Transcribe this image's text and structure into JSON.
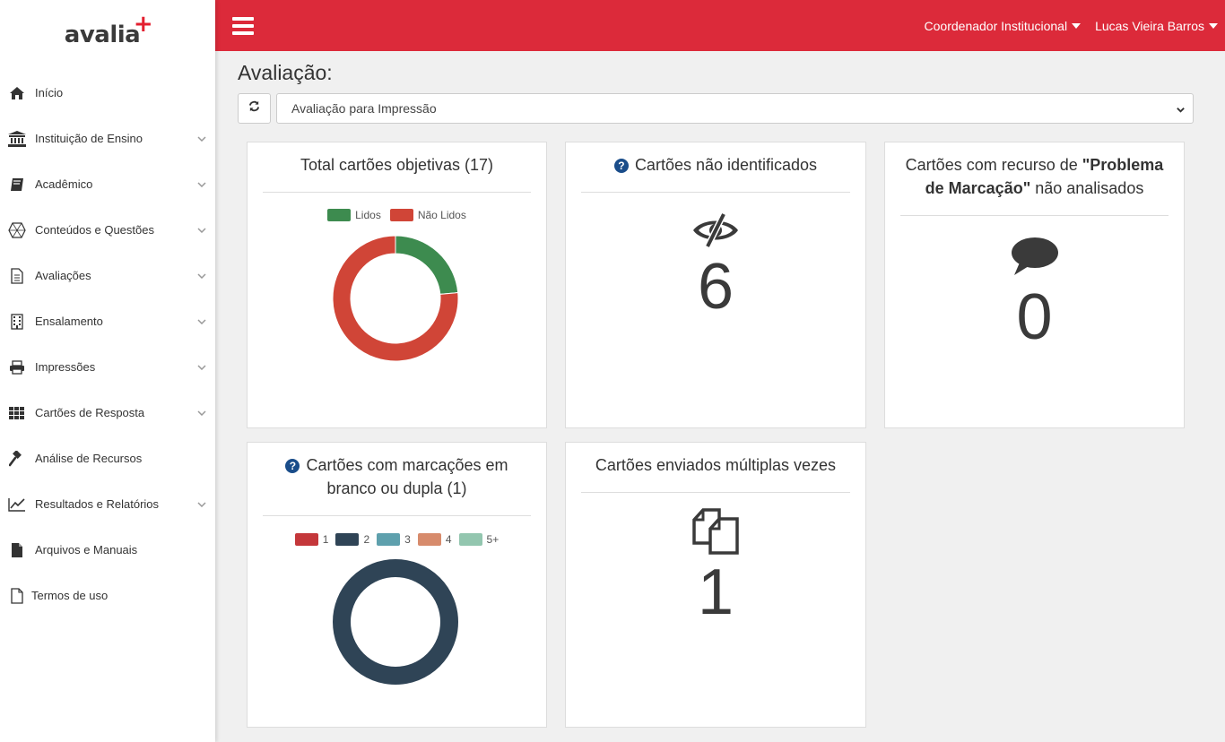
{
  "app": {
    "logo_text": "avalia",
    "logo_plus": "+"
  },
  "sidebar": {
    "items": [
      {
        "label": "Início",
        "icon": "home-icon",
        "has_submenu": false
      },
      {
        "label": "Instituição de Ensino",
        "icon": "institution-icon",
        "has_submenu": true
      },
      {
        "label": "Acadêmico",
        "icon": "book-icon",
        "has_submenu": true
      },
      {
        "label": "Conteúdos e Questões",
        "icon": "cube-icon",
        "has_submenu": true
      },
      {
        "label": "Avaliações",
        "icon": "document-icon",
        "has_submenu": true
      },
      {
        "label": "Ensalamento",
        "icon": "building-icon",
        "has_submenu": true
      },
      {
        "label": "Impressões",
        "icon": "printer-icon",
        "has_submenu": true
      },
      {
        "label": "Cartões de Resposta",
        "icon": "grid-icon",
        "has_submenu": true
      },
      {
        "label": "Análise de Recursos",
        "icon": "gavel-icon",
        "has_submenu": false
      },
      {
        "label": "Resultados e Relatórios",
        "icon": "line-chart-icon",
        "has_submenu": true
      },
      {
        "label": "Arquivos e Manuais",
        "icon": "file-icon",
        "has_submenu": false
      },
      {
        "label": "Termos de uso",
        "icon": "file-outline-icon",
        "has_submenu": false
      }
    ]
  },
  "topbar": {
    "role_menu": "Coordenador Institucional",
    "user_menu": "Lucas Vieira Barros"
  },
  "page": {
    "title": "Avaliação:",
    "select_value": "Avaliação para Impressão"
  },
  "cards": {
    "total": {
      "title": "Total cartões objetivas (17)",
      "legend": [
        {
          "label": "Lidos",
          "color": "#3d8b4f"
        },
        {
          "label": "Não Lidos",
          "color": "#d04537"
        }
      ]
    },
    "unidentified": {
      "title": "Cartões não identificados",
      "value": "6"
    },
    "resource": {
      "title_pre": "Cartões com recurso de ",
      "title_bold": "\"Problema de Marcação\"",
      "title_post": " não analisados",
      "value": "0"
    },
    "blank": {
      "title": "Cartões com marcações em branco ou dupla (1)",
      "legend": [
        {
          "label": "1",
          "color": "#c4373a"
        },
        {
          "label": "2",
          "color": "#2f4456"
        },
        {
          "label": "3",
          "color": "#5ea0ad"
        },
        {
          "label": "4",
          "color": "#d78b6c"
        },
        {
          "label": "5+",
          "color": "#93c6af"
        }
      ]
    },
    "multiple": {
      "title": "Cartões enviados múltiplas vezes",
      "value": "1"
    }
  },
  "chart_data": [
    {
      "type": "pie",
      "title": "Total cartões objetivas (17)",
      "categories": [
        "Lidos",
        "Não Lidos"
      ],
      "values": [
        4,
        13
      ],
      "colors": [
        "#3d8b4f",
        "#d04537"
      ],
      "legend": "top"
    },
    {
      "type": "pie",
      "title": "Cartões com marcações em branco ou dupla (1)",
      "categories": [
        "1",
        "2",
        "3",
        "4",
        "5+"
      ],
      "values": [
        0,
        1,
        0,
        0,
        0
      ],
      "colors": [
        "#c4373a",
        "#2f4456",
        "#5ea0ad",
        "#d78b6c",
        "#93c6af"
      ],
      "legend": "top"
    }
  ]
}
